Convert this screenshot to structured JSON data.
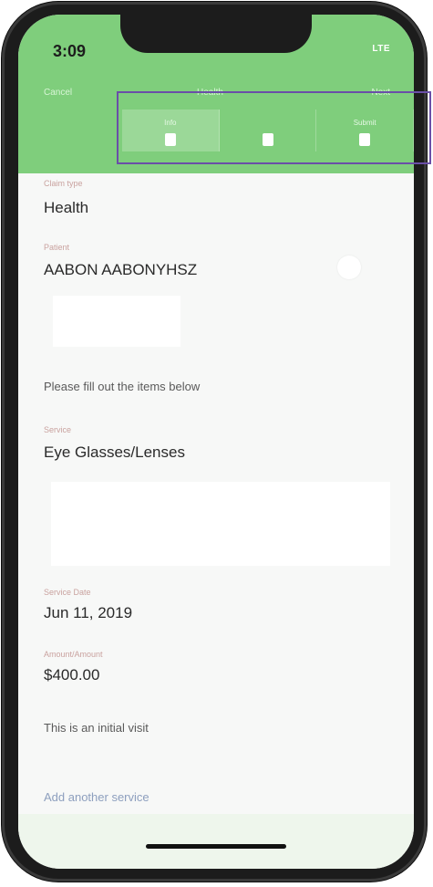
{
  "status_bar": {
    "time": "3:09",
    "network": "LTE"
  },
  "nav": {
    "cancel_label": "Cancel",
    "title": "Health",
    "next_label": "Next"
  },
  "steps": [
    {
      "label": "Info"
    },
    {
      "label": ""
    },
    {
      "label": "Submit"
    }
  ],
  "form": {
    "claim_type_label": "Claim type",
    "claim_type_value": "Health",
    "patient_label": "Patient",
    "patient_value": "AABON AABONYHSZ",
    "instructions": "Please fill out the items below",
    "service_label": "Service",
    "service_value": "Eye Glasses/Lenses",
    "service_date_label": "Service Date",
    "service_date_value": "Jun 11, 2019",
    "amount_label": "Amount/Amount",
    "amount_value": "$400.00",
    "visit_note": "This is an initial visit",
    "add_service_label": "Add another service"
  },
  "colors": {
    "header_green": "#7fce7c",
    "highlight_purple": "#6a4fa8",
    "label_pink": "#c9a29f",
    "link_blue": "#8d9fbe"
  }
}
